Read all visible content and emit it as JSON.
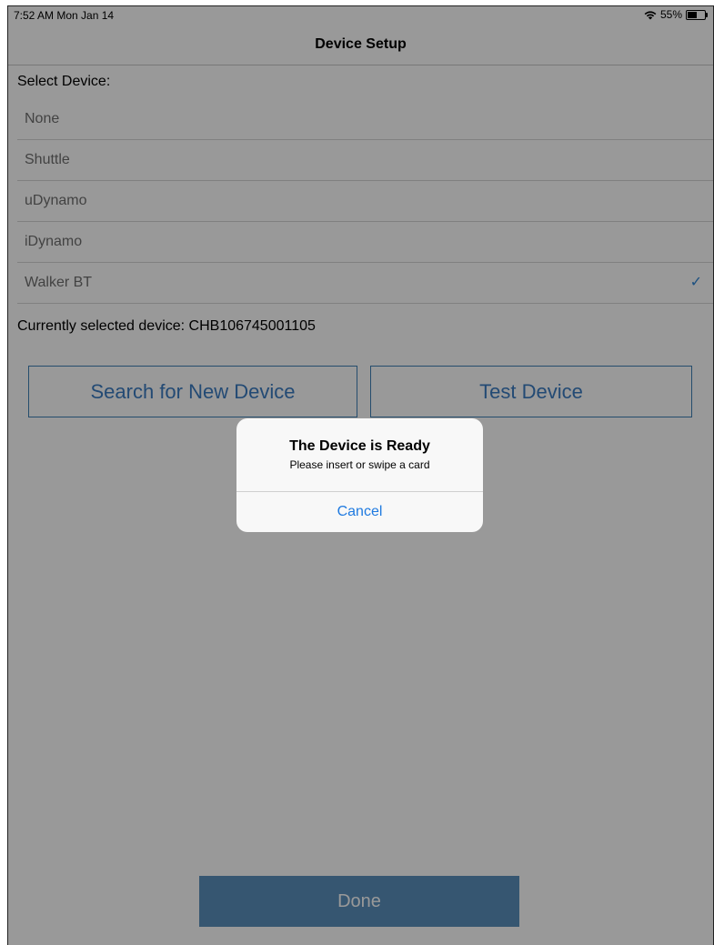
{
  "status_bar": {
    "time": "7:52 AM  Mon Jan 14",
    "wifi_icon": "wifi-icon",
    "battery": "55%",
    "battery_level": 0.55
  },
  "nav": {
    "title": "Device Setup"
  },
  "select_label": "Select Device:",
  "devices": [
    {
      "label": "None"
    },
    {
      "label": "Shuttle"
    },
    {
      "label": "uDynamo"
    },
    {
      "label": "iDynamo"
    },
    {
      "label": "Walker BT",
      "checkmark": "✓",
      "selected": true
    }
  ],
  "current_device_text": "Currently selected device: CHB106745001105",
  "buttons": {
    "search": "Search for New Device",
    "test": "Test Device",
    "done": "Done"
  },
  "alert": {
    "title": "The Device is Ready",
    "message": "Please insert or swipe a card",
    "cancel": "Cancel"
  },
  "colors": {
    "accent": "#1f7ae0",
    "button_outline": "#3f80b6",
    "done_background": "#5b8fbd",
    "overlay": "rgba(0,0,0,0.40)"
  }
}
